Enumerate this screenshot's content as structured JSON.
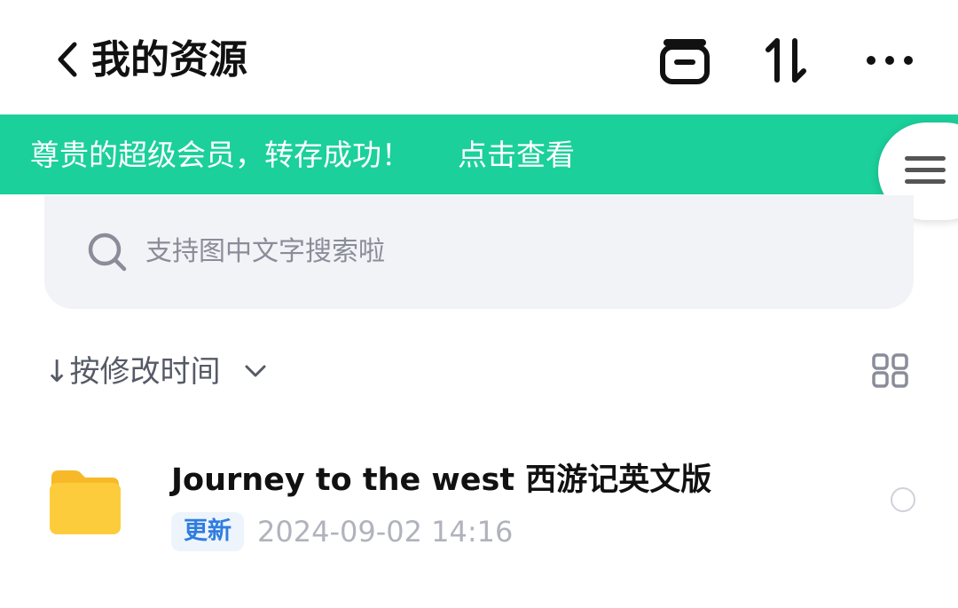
{
  "header": {
    "title": "我的资源",
    "icons": {
      "back": "chevron-left-icon",
      "folder": "folder-outline-icon",
      "sort": "sort-arrows-icon",
      "more": "more-dots-icon"
    }
  },
  "banner": {
    "message": "尊贵的超级会员，转存成功！",
    "link": "点击查看",
    "color": "#1bd09b",
    "menu_icon": "hamburger-icon"
  },
  "search": {
    "placeholder": "支持图中文字搜索啦",
    "icon": "search-icon"
  },
  "sort_bar": {
    "label": "↓按修改时间",
    "chevron_icon": "chevron-down-icon",
    "view_icon": "grid-view-icon"
  },
  "files": [
    {
      "name": "Journey to the west 西游记英文版",
      "badge": "更新",
      "date": "2024-09-02 14:16",
      "icon": "folder-icon"
    }
  ]
}
